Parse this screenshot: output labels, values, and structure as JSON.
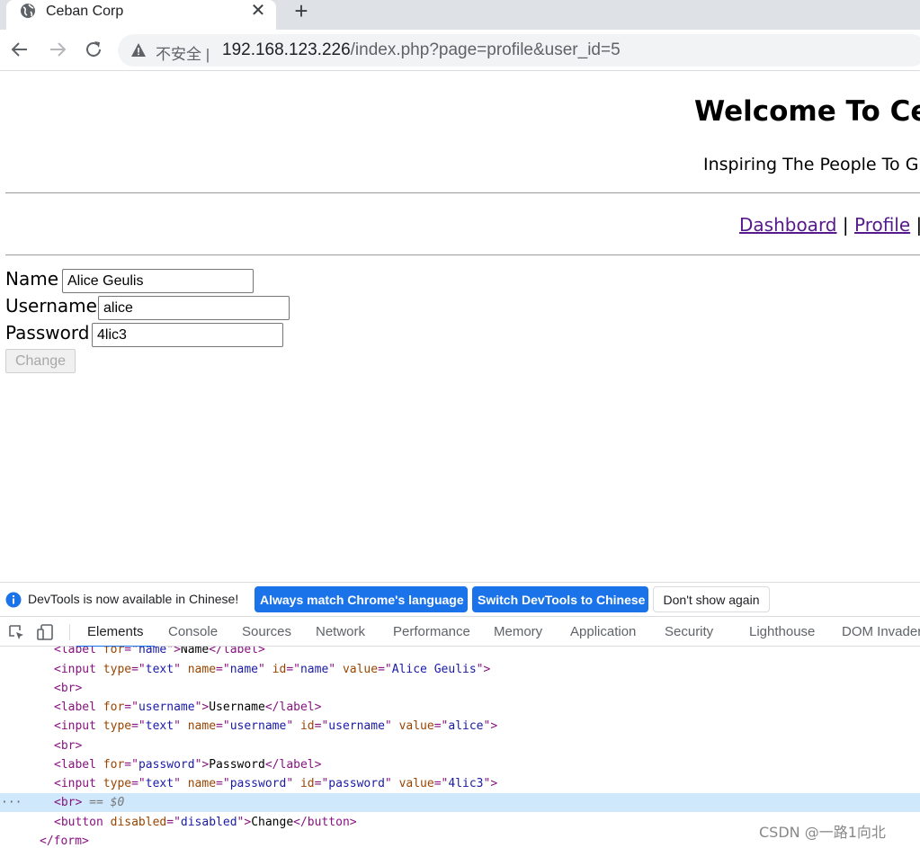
{
  "browser": {
    "tab_title": "Ceban Corp",
    "insecure_label": "不安全",
    "url_host": "192.168.123.226",
    "url_path": "/index.php?page=profile&user_id=5"
  },
  "page": {
    "heading": "Welcome To Ceb",
    "tagline": "Inspiring The People To G",
    "nav": {
      "dashboard": "Dashboard",
      "profile": "Profile",
      "separator": "|"
    },
    "form": {
      "name_label": "Name",
      "name_value": "Alice Geulis",
      "username_label": "Username",
      "username_value": "alice",
      "password_label": "Password",
      "password_value": "4lic3",
      "change_label": "Change"
    }
  },
  "devtools": {
    "infobar_text": "DevTools is now available in Chinese!",
    "btn_match": "Always match Chrome's language",
    "btn_switch": "Switch DevTools to Chinese",
    "btn_dismiss": "Don't show again",
    "tabs": [
      "Elements",
      "Console",
      "Sources",
      "Network",
      "Performance",
      "Memory",
      "Application",
      "Security",
      "Lighthouse",
      "DOM Invader"
    ],
    "selected_marker": "== $0",
    "ellipsis": "···"
  },
  "watermark": "CSDN @一路1向北",
  "colors": {
    "accent": "#1a73e8",
    "link_visited": "#551a8b",
    "selected_row": "#cfe8fc"
  }
}
